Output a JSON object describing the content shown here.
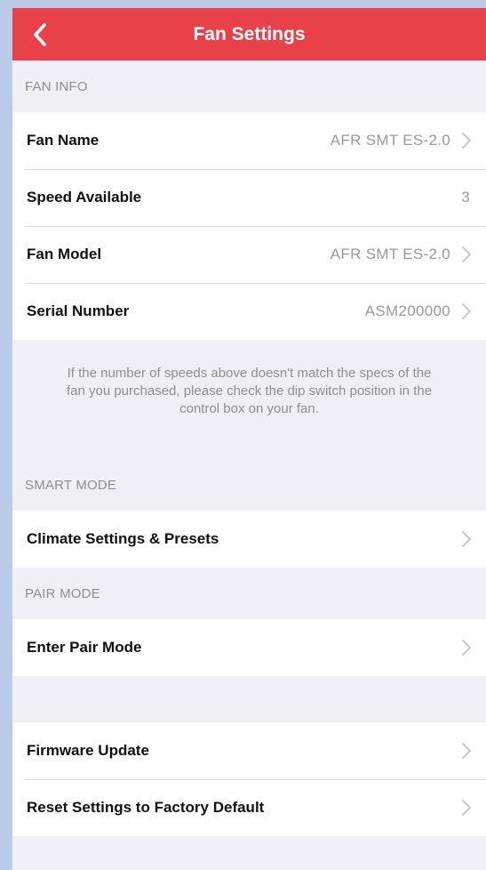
{
  "navbar": {
    "title": "Fan Settings",
    "back_icon": "chevron-left-icon",
    "color": "#e8414a"
  },
  "fan_info": {
    "header": "FAN INFO",
    "rows": [
      {
        "label": "Fan Name",
        "value": "AFR SMT ES-2.0"
      },
      {
        "label": "Speed Available",
        "value": "3"
      },
      {
        "label": "Fan Model",
        "value": "AFR SMT ES-2.0"
      },
      {
        "label": "Serial Number",
        "value": "ASM200000"
      }
    ],
    "note": "If the number of speeds above doesn't match the specs of the fan you purchased, please check the dip switch position in the control box on your fan."
  },
  "smart_mode": {
    "header": "SMART MODE",
    "rows": [
      {
        "label": "Climate Settings & Presets"
      }
    ]
  },
  "pair_mode": {
    "header": "PAIR MODE",
    "rows": [
      {
        "label": "Enter Pair Mode"
      }
    ]
  },
  "other": {
    "rows": [
      {
        "label": "Firmware Update"
      },
      {
        "label": "Reset Settings to Factory Default"
      }
    ]
  }
}
